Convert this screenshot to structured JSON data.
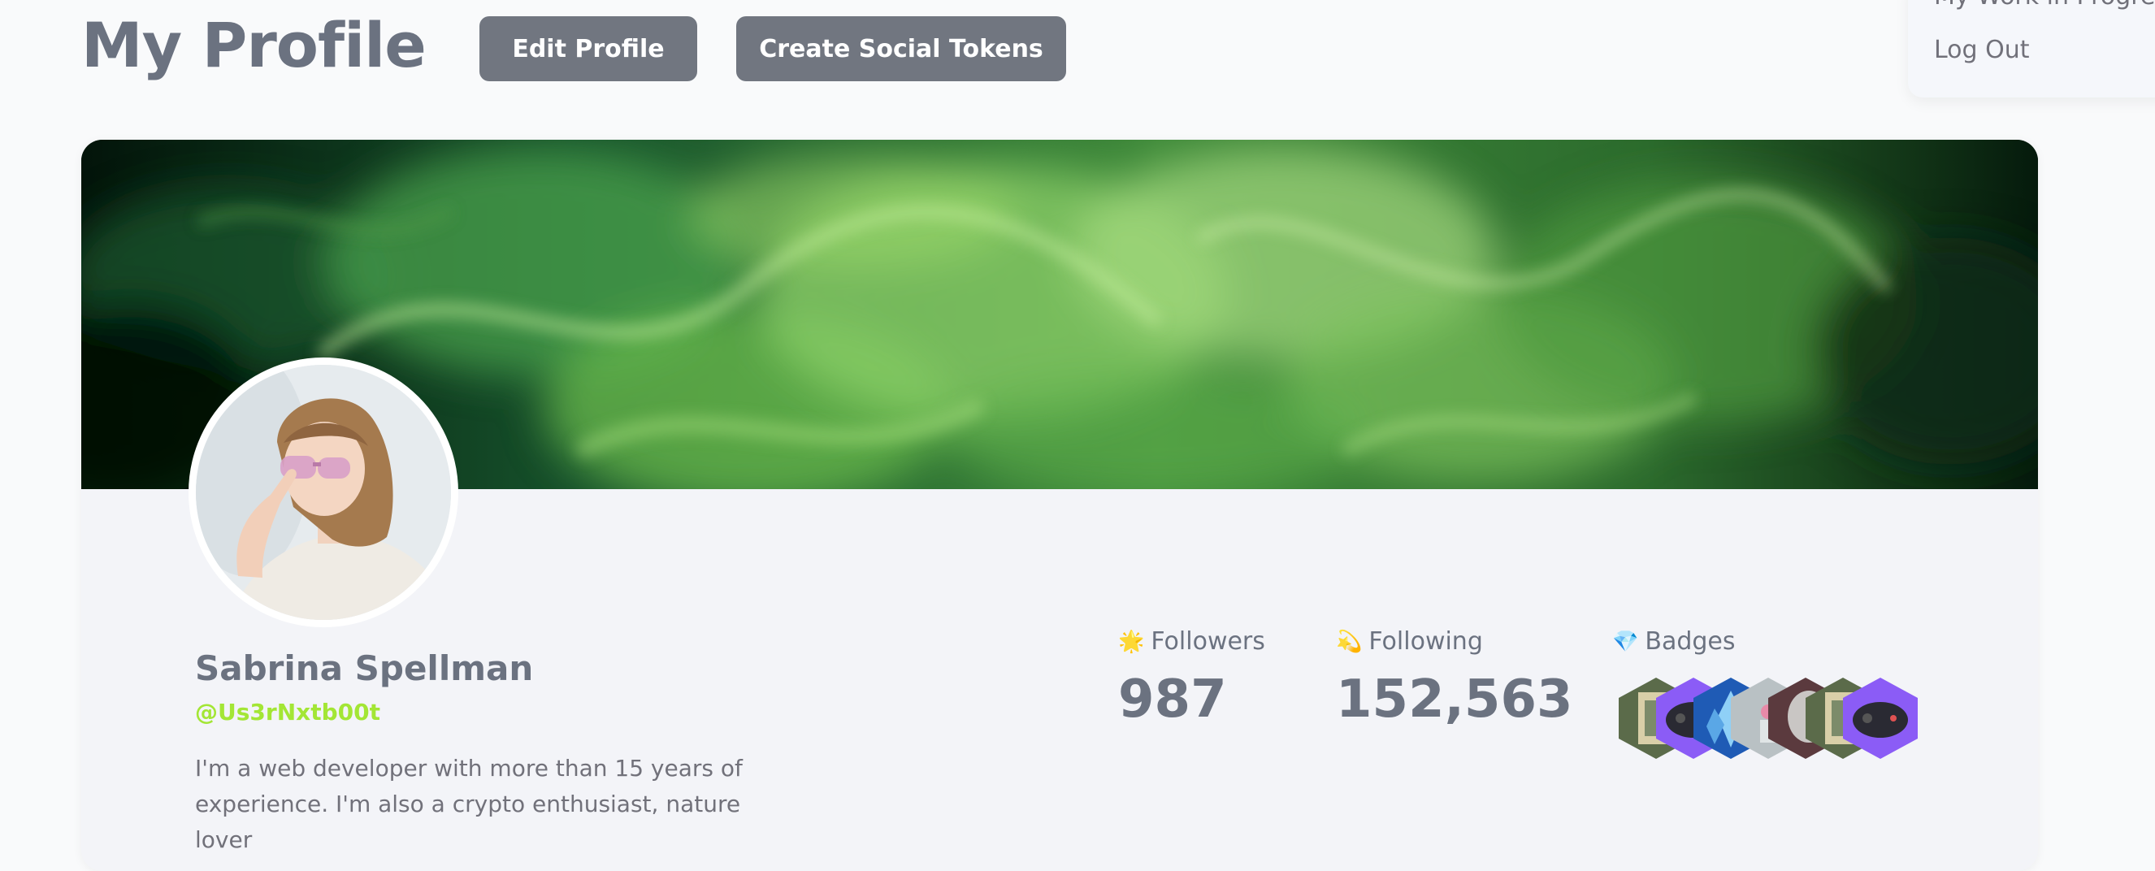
{
  "header": {
    "title": "My Profile",
    "edit_profile_label": "Edit Profile",
    "create_tokens_label": "Create Social Tokens"
  },
  "dropdown_menu": {
    "items": [
      {
        "label": "My Work in Progress"
      },
      {
        "label": "Log Out"
      }
    ]
  },
  "profile": {
    "name": "Sabrina Spellman",
    "handle": "@Us3rNxtb00t",
    "bio": "I'm a web developer with more than 15 years of experience. I'm also a crypto enthusiast, nature lover",
    "stats": {
      "followers": {
        "icon": "star-icon",
        "label": "Followers",
        "value": "987"
      },
      "following": {
        "icon": "comet-icon",
        "label": "Following",
        "value": "152,563"
      },
      "badges": {
        "icon": "gem-icon",
        "label": "Badges"
      }
    },
    "badges": [
      {
        "name": "badge-painting"
      },
      {
        "name": "badge-gamepad"
      },
      {
        "name": "badge-crystal"
      },
      {
        "name": "badge-potion"
      },
      {
        "name": "badge-statue"
      },
      {
        "name": "badge-painting"
      },
      {
        "name": "badge-gamepad"
      }
    ]
  },
  "colors": {
    "button_bg": "#717680",
    "handle_accent": "#a3e635",
    "card_bg": "#f3f4f8",
    "page_bg": "#f9fafb"
  }
}
